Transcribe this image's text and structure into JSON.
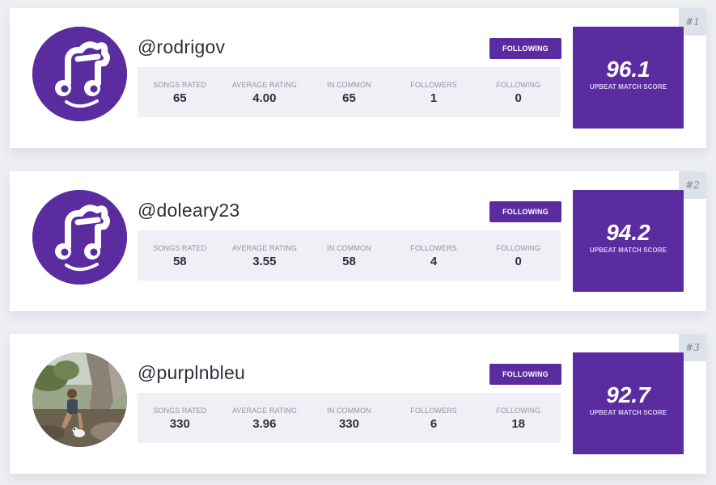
{
  "matches": [
    {
      "rank": "#1",
      "username": "@rodrigov",
      "avatar_icon": "note-face-icon",
      "follow_label": "FOLLOWING",
      "stats": [
        {
          "label": "SONGS RATED",
          "value": "65"
        },
        {
          "label": "AVERAGE RATING",
          "value": "4.00"
        },
        {
          "label": "IN COMMON",
          "value": "65"
        },
        {
          "label": "FOLLOWERS",
          "value": "1"
        },
        {
          "label": "FOLLOWING",
          "value": "0"
        }
      ],
      "score": "96.1",
      "score_label": "UPBEAT MATCH SCORE"
    },
    {
      "rank": "#2",
      "username": "@doleary23",
      "avatar_icon": "note-face-icon",
      "follow_label": "FOLLOWING",
      "stats": [
        {
          "label": "SONGS RATED",
          "value": "58"
        },
        {
          "label": "AVERAGE RATING",
          "value": "3.55"
        },
        {
          "label": "IN COMMON",
          "value": "58"
        },
        {
          "label": "FOLLOWERS",
          "value": "4"
        },
        {
          "label": "FOLLOWING",
          "value": "0"
        }
      ],
      "score": "94.2",
      "score_label": "UPBEAT MATCH SCORE"
    },
    {
      "rank": "#3",
      "username": "@purplnbleu",
      "avatar_icon": "user-photo",
      "follow_label": "FOLLOWING",
      "stats": [
        {
          "label": "SONGS RATED",
          "value": "330"
        },
        {
          "label": "AVERAGE RATING",
          "value": "3.96"
        },
        {
          "label": "IN COMMON",
          "value": "330"
        },
        {
          "label": "FOLLOWERS",
          "value": "6"
        },
        {
          "label": "FOLLOWING",
          "value": "18"
        }
      ],
      "score": "92.7",
      "score_label": "UPBEAT MATCH SCORE"
    }
  ],
  "colors": {
    "accent": "#5b2ca0",
    "background": "#eeeff3",
    "stats_panel": "#eff0f5",
    "rank_badge": "#dde1ea"
  }
}
